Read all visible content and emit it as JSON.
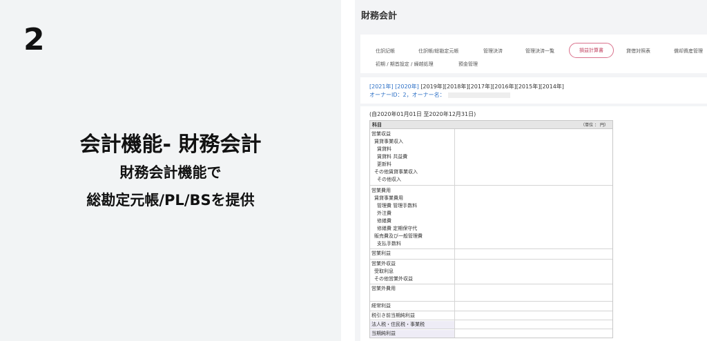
{
  "left": {
    "step_number": "2",
    "headline": "会計機能- 財務会計",
    "subline1": "財務会計機能で",
    "subline2": "総勘定元帳/PL/BSを提供"
  },
  "app": {
    "title": "財務会計",
    "tabs": [
      {
        "label": "仕訳記帳",
        "active": false
      },
      {
        "label": "仕訳帳/総勘定元帳",
        "active": false
      },
      {
        "label": "管理決済",
        "active": false
      },
      {
        "label": "管理決済一覧",
        "active": false
      },
      {
        "label": "損益計算書",
        "active": true
      },
      {
        "label": "貸借対照表",
        "active": false
      },
      {
        "label": "償却資産管理",
        "active": false
      },
      {
        "label": "初期 / 期首設定 / 繰越処理",
        "active": false
      },
      {
        "label": "預金管理",
        "active": false
      }
    ],
    "years": {
      "link1": "[2021年]",
      "link2": "[2020年]",
      "rest": "[2019年][2018年][2017年][2016年][2015年][2014年]"
    },
    "owner_label": "オーナーID：2，オーナー名：",
    "period": "(自2020年01月01日 至2020年12月31日)",
    "table": {
      "header_label": "科目",
      "unit": "（単位 ： 円）",
      "groups": [
        {
          "rows": [
            "営業収益",
            "賃貸事業収入",
            "賃貸料",
            "賃貸料 共益費",
            "更新料",
            "その他賃貸事業収入",
            "その他収入"
          ]
        },
        {
          "rows": [
            "営業費用",
            "賃貸事業費用",
            "管理費 管理手数料",
            "外注費",
            "修繕費",
            "修繕費 定期保守代",
            "販売費及び一般管理費",
            "支払手数料"
          ]
        },
        {
          "rows": [
            "営業利益"
          ]
        },
        {
          "rows": [
            "営業外収益",
            "受取利息",
            "その他営業外収益"
          ]
        },
        {
          "rows": [
            "営業外費用"
          ]
        },
        {
          "rows": [
            "経常利益"
          ]
        },
        {
          "rows": [
            "税引き前当期純利益"
          ]
        },
        {
          "rows": [
            "法人税・住民税・事業税"
          ]
        },
        {
          "rows": [
            "当期純利益"
          ]
        }
      ]
    }
  }
}
